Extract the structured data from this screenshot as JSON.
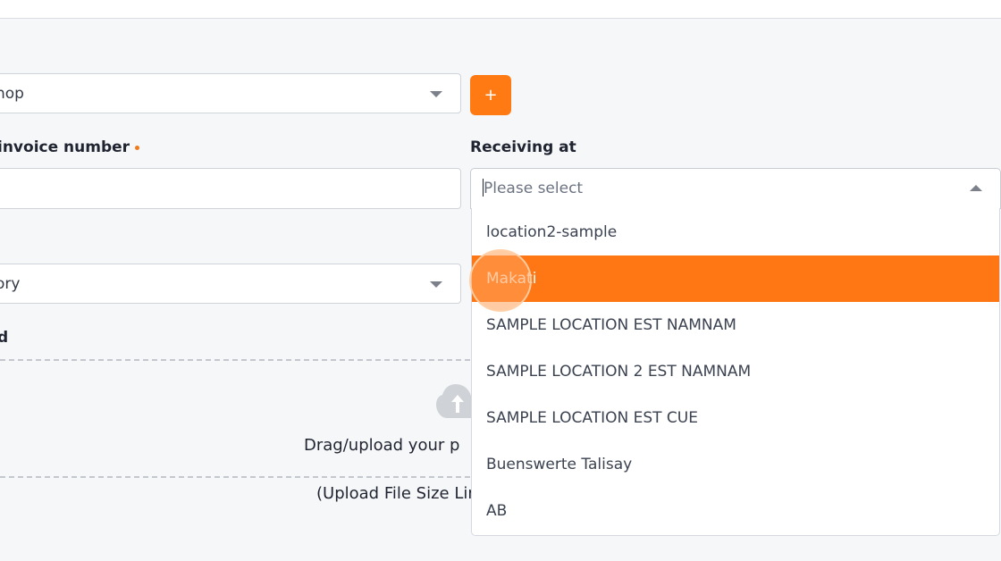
{
  "form": {
    "supplier_value": "hop",
    "add_button_label": "+",
    "invoice_label": "invoice number",
    "invoice_value": "",
    "receiving_label": "Receiving at",
    "receiving_placeholder": "Please select",
    "left_label_partial": "",
    "category_value": "ory",
    "upload_label_partial": "d"
  },
  "upload": {
    "drag_text": "Drag/upload your p",
    "limit_text": "(Upload File Size Lin"
  },
  "dropdown": {
    "options": [
      "location2-sample",
      "Makati",
      "SAMPLE LOCATION EST NAMNAM",
      "SAMPLE LOCATION 2 EST NAMNAM",
      "SAMPLE LOCATION EST CUE",
      "Buenswerte Talisay",
      "AB"
    ],
    "highlighted": "Makati"
  },
  "colors": {
    "accent": "#ff7a12",
    "highlight": "#ff7714",
    "required_dot": "#f07a1a"
  }
}
